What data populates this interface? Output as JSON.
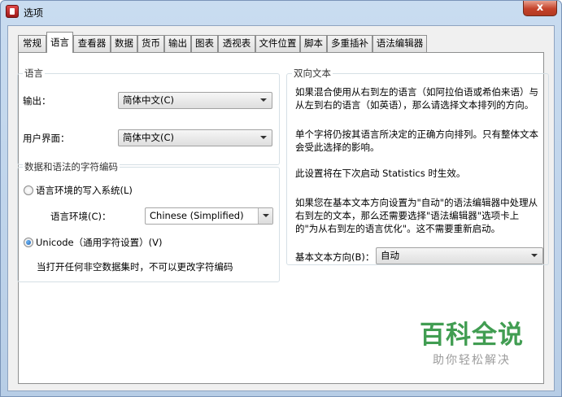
{
  "window": {
    "title": "选项",
    "close_glyph": "x"
  },
  "tabs": [
    {
      "label": "常规"
    },
    {
      "label": "语言"
    },
    {
      "label": "查看器"
    },
    {
      "label": "数据"
    },
    {
      "label": "货币"
    },
    {
      "label": "输出"
    },
    {
      "label": "图表"
    },
    {
      "label": "透视表"
    },
    {
      "label": "文件位置"
    },
    {
      "label": "脚本"
    },
    {
      "label": "多重插补"
    },
    {
      "label": "语法编辑器"
    }
  ],
  "active_tab": "语言",
  "language": {
    "group_title": "语言",
    "output_label": "输出：",
    "output_value": "简体中文(C)",
    "ui_label": "用户界面：",
    "ui_value": "简体中文(C)"
  },
  "encoding": {
    "group_title": "数据和语法的字符编码",
    "locale_radio_label": "语言环境的写入系统(L)",
    "locale_label": "语言环境(C)：",
    "locale_value": "Chinese (Simplified)",
    "unicode_radio_label": "Unicode（通用字符设置）(V)",
    "selected": "unicode",
    "note": "当打开任何非空数据集时，不可以更改字符编码"
  },
  "bidi": {
    "group_title": "双向文本",
    "para1": "如果混合使用从右到左的语言（如阿拉伯语或希伯来语）与从左到右的语言（如英语），那么请选择文本排列的方向。",
    "para2": "单个字将仍按其语言所决定的正确方向排列。只有整体文本会受此选择的影响。",
    "para3": "此设置将在下次启动 Statistics 时生效。",
    "para4": "如果您在基本文本方向设置为\"自动\"的语法编辑器中处理从右到左的文本，那么还需要选择\"语法编辑器\"选项卡上的\"为从右到左的语言优化\"。这不需要重新启动。",
    "direction_label": "基本文本方向(B)：",
    "direction_value": "自动"
  },
  "watermark": {
    "main": "百科全说",
    "sub": "助你轻松解决"
  }
}
